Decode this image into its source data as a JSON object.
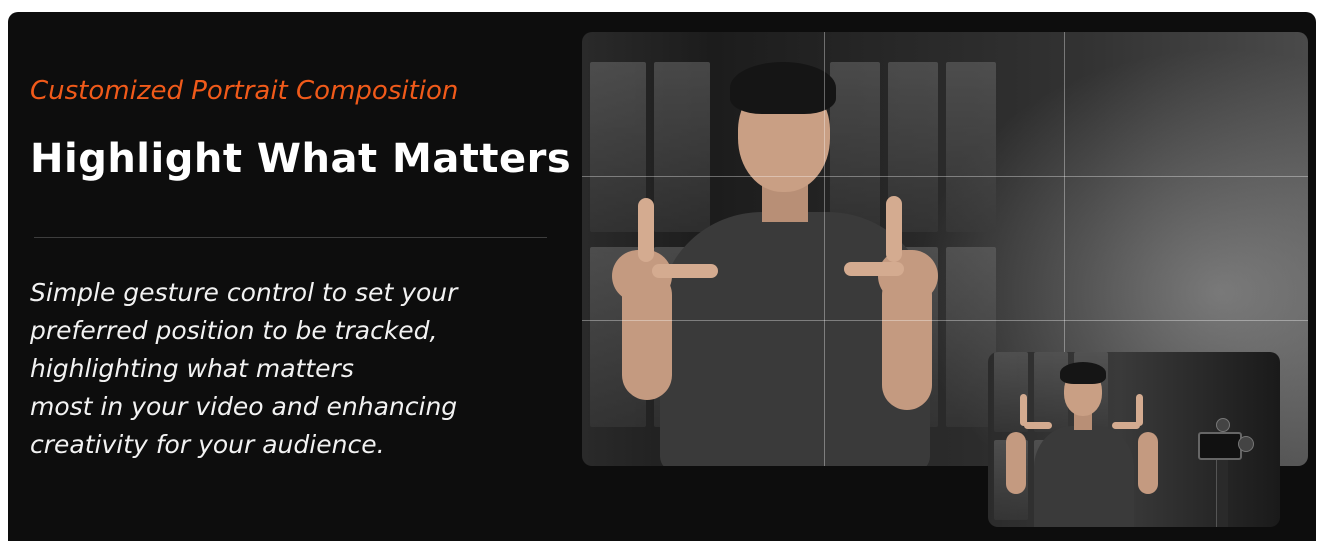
{
  "hero_section": {
    "eyebrow": "Customized Portrait Composition",
    "headline": "Highlight What Matters",
    "description_lines": [
      "Simple gesture control to set your",
      "preferred position to be tracked,",
      "highlighting what matters",
      "most in your video and enhancing",
      "creativity for your audience."
    ]
  },
  "colors": {
    "background": "#0d0d0d",
    "accent": "#f05a1a",
    "headline": "#ffffff",
    "body_text": "#f2f2f2"
  },
  "media": {
    "main_image": "portrait-gesture-photo",
    "inset_image": "gimbal-tracking-preview-photo",
    "overlay": "rule-of-thirds-grid"
  }
}
